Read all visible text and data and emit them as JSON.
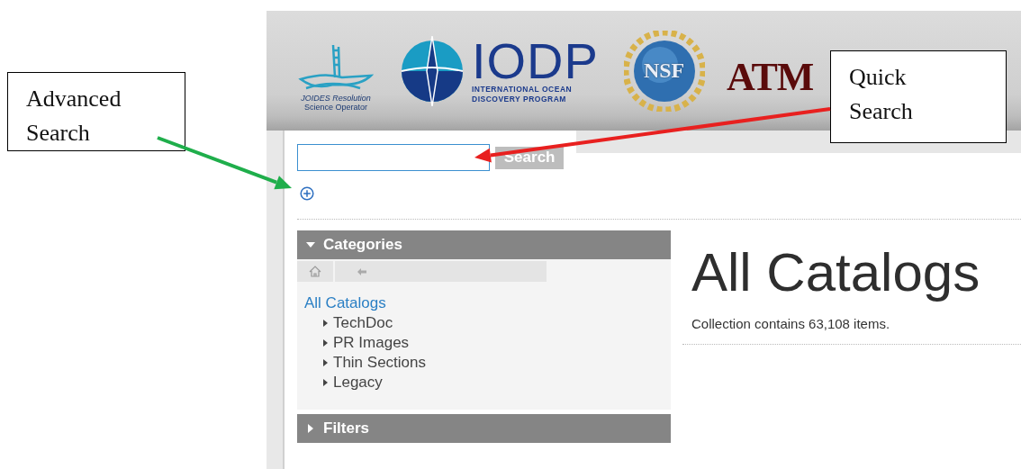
{
  "header": {
    "joides": {
      "line_1": "JOIDES Resolution",
      "line_2": "Science Operator"
    },
    "iodp": {
      "name": "IODP",
      "line_1": "INTERNATIONAL OCEAN",
      "line_2": "DISCOVERY PROGRAM"
    },
    "nsf": {
      "name": "NSF"
    },
    "tamu": {
      "name": "ATM"
    }
  },
  "search": {
    "button": "Search"
  },
  "categories": {
    "title": "Categories",
    "expanded": true,
    "root": {
      "label": "All Catalogs",
      "children": [
        {
          "label": "TechDoc",
          "expanded": false
        },
        {
          "label": "PR Images",
          "expanded": false
        },
        {
          "label": "Thin Sections",
          "expanded": false
        },
        {
          "label": "Legacy",
          "expanded": false
        }
      ]
    }
  },
  "filters": {
    "title": "Filters",
    "expanded": false
  },
  "content": {
    "title": "All Catalogs",
    "summary": "Collection contains 63,108 items."
  },
  "annotations": [
    {
      "text": "Advanced Search",
      "color": "#1fae4b"
    },
    {
      "text": "Quick Search",
      "color": "#e8201f"
    }
  ]
}
